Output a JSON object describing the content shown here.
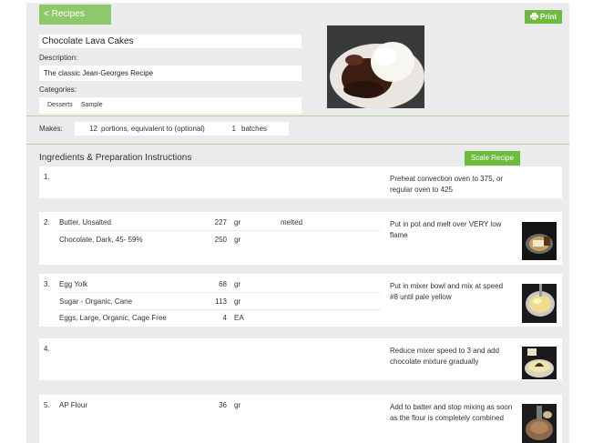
{
  "nav": {
    "back_label": "< Recipes",
    "print_label": "Print"
  },
  "recipe": {
    "title": "Chocolate Lava Cakes",
    "description_label": "Description:",
    "description": "The classic Jean-Georges Recipe",
    "categories_label": "Categories:",
    "categories": [
      "Desserts",
      "Sample"
    ],
    "makes_label": "Makes:",
    "portions_value": "12",
    "portions_text": "portions, equivalent to (optional)",
    "batches_value": "1",
    "batches_text": "batches"
  },
  "section": {
    "title": "Ingredients & Preparation Instructions",
    "scale_label": "Scale Recipe"
  },
  "steps": [
    {
      "number": "1.",
      "ingredients": [],
      "instruction": "Preheat convection oven to 375, or regular oven to 425"
    },
    {
      "number": "2.",
      "ingredients": [
        {
          "name": "Butter, Unsalted",
          "qty": "227",
          "unit": "gr",
          "note": "melted"
        },
        {
          "name": "Chocolate, Dark, 45- 59%",
          "qty": "250",
          "unit": "gr",
          "note": ""
        }
      ],
      "instruction": "Put in pot and melt over VERY low flame"
    },
    {
      "number": "3.",
      "ingredients": [
        {
          "name": "Egg Yolk",
          "qty": "68",
          "unit": "gr",
          "note": ""
        },
        {
          "name": "Sugar - Organic, Cane",
          "qty": "113",
          "unit": "gr",
          "note": ""
        },
        {
          "name": "Eggs, Large, Organic, Cage Free",
          "qty": "4",
          "unit": "EA",
          "note": ""
        }
      ],
      "instruction": "Put in mixer bowl and mix at speed #8 until pale yellow"
    },
    {
      "number": "4.",
      "ingredients": [],
      "instruction": "Reduce mixer speed to 3 and add chocolate mixture gradually"
    },
    {
      "number": "5.",
      "ingredients": [
        {
          "name": "AP Flour",
          "qty": "36",
          "unit": "gr",
          "note": ""
        }
      ],
      "instruction": "Add to batter and stop mixing as soon as the flour is completely combined"
    }
  ],
  "colors": {
    "accent_green": "#6cbb3c",
    "back_button": "#8fc86a",
    "divider": "#b5d2a2",
    "panel_bg": "#ebebeb"
  },
  "icons": {
    "print": "printer-icon"
  }
}
